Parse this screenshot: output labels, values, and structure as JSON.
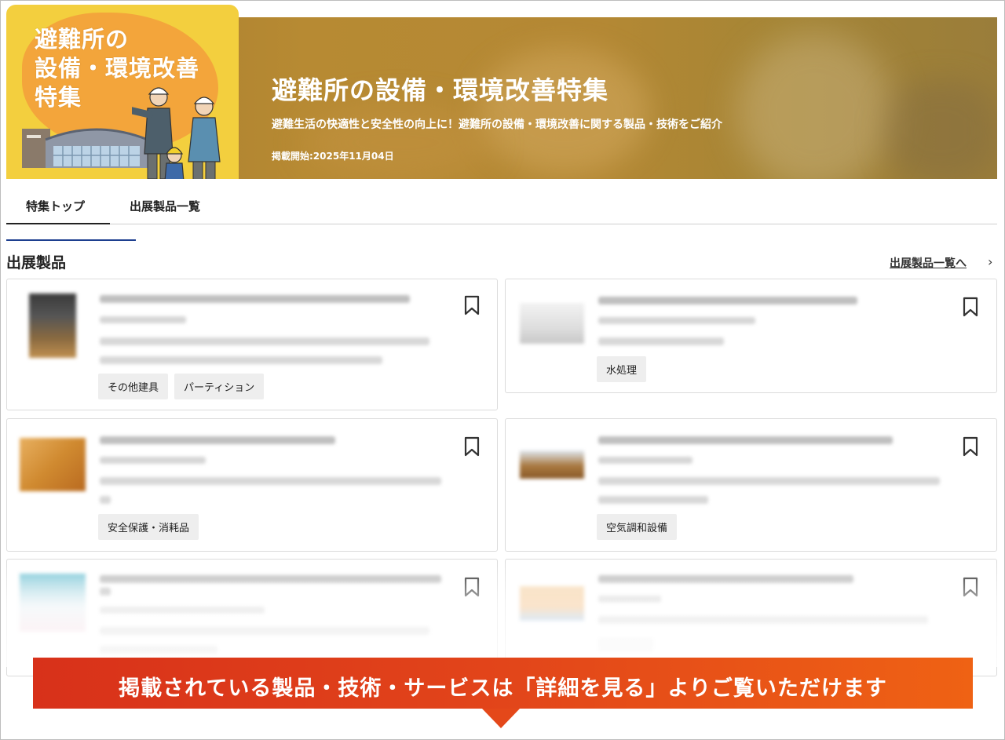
{
  "banner": {
    "illustration_title_lines": [
      "避難所の",
      "設備・環境改善",
      "特集"
    ],
    "title": "避難所の設備・環境改善特集",
    "subtitle": "避難生活の快適性と安全性の向上に！避難所の設備・環境改善に関する製品・技術をご紹介",
    "date": "掲載開始:2025年11月04日"
  },
  "tabs": [
    {
      "label": "特集トップ",
      "active": true
    },
    {
      "label": "出展製品一覧",
      "active": false
    }
  ],
  "section": {
    "title": "出展製品",
    "list_link": "出展製品一覧へ",
    "list_link_arrow": "›"
  },
  "cards": [
    {
      "tags": [
        "その他建具",
        "パーティション"
      ],
      "bookmark_icon": "bookmark-icon"
    },
    {
      "tags": [
        "水処理"
      ],
      "bookmark_icon": "bookmark-icon"
    },
    {
      "tags": [
        "安全保護・消耗品"
      ],
      "bookmark_icon": "bookmark-icon"
    },
    {
      "tags": [
        "空気調和設備"
      ],
      "bookmark_icon": "bookmark-icon"
    },
    {
      "tags": [],
      "bookmark_icon": "bookmark-icon"
    },
    {
      "tags": [],
      "bookmark_icon": "bookmark-icon"
    }
  ],
  "callout": {
    "text": "掲載されている製品・技術・サービスは「詳細を見る」よりご覧いただけます"
  },
  "colors": {
    "banner_bg": "#b08532",
    "illustration_bg": "#f3cf3e",
    "tab_accent": "#1d3f8f",
    "callout_start": "#d8311a",
    "callout_end": "#ef6214",
    "tag_bg": "#eeeeee"
  }
}
